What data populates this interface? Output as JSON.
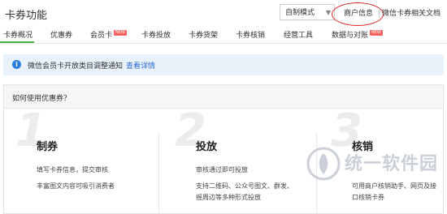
{
  "header": {
    "title": "卡券功能",
    "mode_select": "自制模式",
    "merchant_info": "商户信息",
    "doc_link": "微信卡券相关文档"
  },
  "tabs": [
    {
      "label": "卡券概况",
      "active": true,
      "badge": ""
    },
    {
      "label": "优惠券",
      "active": false,
      "badge": ""
    },
    {
      "label": "会员卡",
      "active": false,
      "badge": "NEW"
    },
    {
      "label": "卡券投放",
      "active": false,
      "badge": ""
    },
    {
      "label": "卡券货架",
      "active": false,
      "badge": ""
    },
    {
      "label": "卡券核销",
      "active": false,
      "badge": ""
    },
    {
      "label": "经营工具",
      "active": false,
      "badge": ""
    },
    {
      "label": "数据与对账",
      "active": false,
      "badge": "NEW"
    }
  ],
  "notice": {
    "icon": "info-icon",
    "text": "微信会员卡开放类目调整通知",
    "link": "查看详情"
  },
  "guide": {
    "title": "如何使用优惠券？",
    "steps": [
      {
        "number": "1",
        "title": "制券",
        "lines": [
          "填写卡券信息，提交审核",
          "丰富图文内容可吸引消费者"
        ]
      },
      {
        "number": "2",
        "title": "投放",
        "lines": [
          "审核通过即可投放",
          "支持二维码、公众号图文、群发、",
          "摇周边等多种形式投放"
        ]
      },
      {
        "number": "3",
        "title": "核销",
        "lines": [
          "可用商户核销助手、网页及接",
          "口核销卡券"
        ]
      }
    ]
  },
  "watermark": "统一软件园",
  "colors": {
    "accent_green": "#44b549",
    "highlight_red": "#e32727",
    "notice_bg": "#e9f1fb",
    "link_blue": "#2a6ad1"
  }
}
